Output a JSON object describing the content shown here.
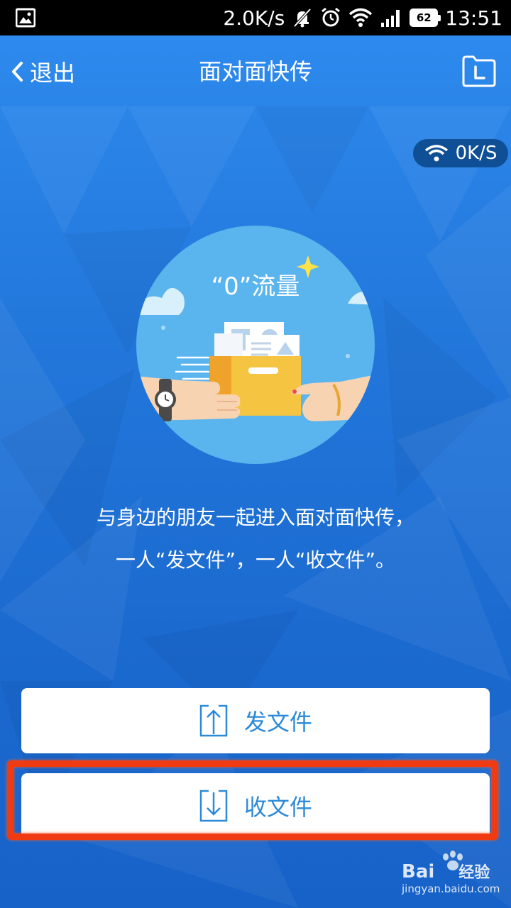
{
  "status_bar": {
    "network_speed": "2.0K/s",
    "battery_level": "62",
    "time": "13:51"
  },
  "header": {
    "back_label": "退出",
    "title": "面对面快传"
  },
  "speed_indicator": {
    "value": "0K/S"
  },
  "illustration": {
    "caption": "“0”流量"
  },
  "description": {
    "line1": "与身边的朋友一起进入面对面快传，",
    "line2": "一人“发文件”，一人“收文件”。"
  },
  "actions": {
    "send_label": "发文件",
    "receive_label": "收文件"
  },
  "watermark": {
    "brand": "Bai",
    "brand_suffix": "经验",
    "url": "jingyan.baidu.com"
  },
  "colors": {
    "background": "#2378dc",
    "accent_text": "#2d8ad8",
    "highlight": "#f03a12"
  }
}
